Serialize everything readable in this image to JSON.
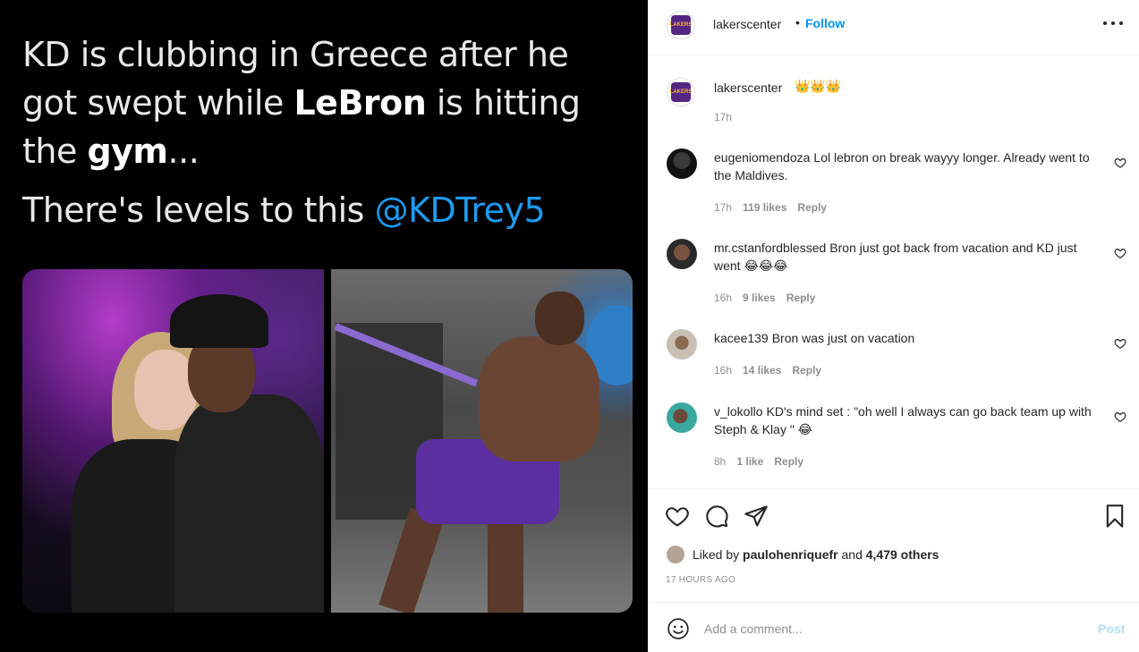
{
  "post": {
    "tweet": {
      "line1_pre": "KD is clubbing in Greece after he got swept while ",
      "line1_bold1": "LeBron",
      "line1_mid": " is hitting the ",
      "line1_bold2": "gym",
      "line1_post": "...",
      "line2_pre": "There's levels to this ",
      "mention": "@KDTrey5"
    },
    "logo_text": "LAKERS",
    "colors": {
      "mention": "#1d9bf0",
      "follow": "#0095f6",
      "post_disabled": "#b2dffc",
      "lakers_purple": "#552583",
      "lakers_gold": "#fdb927"
    }
  },
  "header": {
    "username": "lakerscenter",
    "separator": "•",
    "follow_label": "Follow"
  },
  "caption": {
    "username": "lakerscenter",
    "emojis": "👑👑👑",
    "time": "17h"
  },
  "comments": [
    {
      "username": "eugeniomendoza",
      "text": "Lol lebron on break wayyy longer. Already went to the Maldives.",
      "time": "17h",
      "likes": "119 likes",
      "reply": "Reply"
    },
    {
      "username": "mr.cstanfordblessed",
      "text": "Bron just got back from vacation and KD just went 😂😂😂",
      "time": "16h",
      "likes": "9 likes",
      "reply": "Reply"
    },
    {
      "username": "kacee139",
      "text": "Bron was just on vacation",
      "time": "16h",
      "likes": "14 likes",
      "reply": "Reply"
    },
    {
      "username": "v_lokollo",
      "text": "KD's mind set : \"oh well I always can go back team up with Steph & Klay \" 😂",
      "time": "8h",
      "likes": "1 like",
      "reply": "Reply"
    }
  ],
  "likes": {
    "prefix": "Liked by ",
    "user": "paulohenriquefr",
    "and": " and ",
    "others": "4,479 others"
  },
  "timestamp": "17 HOURS AGO",
  "add_comment": {
    "placeholder": "Add a comment...",
    "post_label": "Post"
  },
  "icons": [
    "heart-icon",
    "comment-icon",
    "share-icon",
    "bookmark-icon",
    "emoji-icon",
    "more-icon"
  ]
}
